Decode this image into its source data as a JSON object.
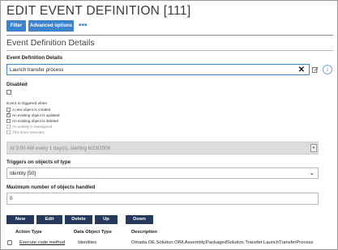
{
  "page": {
    "title": "EDIT EVENT DEFINITION [111]"
  },
  "toolbar": {
    "filter_label": "Filter",
    "advanced_label": "Advanced options",
    "more_label": "•••"
  },
  "section": {
    "title": "Event Definition Details"
  },
  "form": {
    "name_label": "Event Definition Details",
    "name_value": "Launch transfer process",
    "disabled_label": "Disabled",
    "disabled_checked": false,
    "trigger_label": "Event is triggered when",
    "trigger_options": [
      {
        "label": "A new object is created",
        "checked": false,
        "muted": false
      },
      {
        "label": "An existing object is updated",
        "checked": true,
        "muted": false
      },
      {
        "label": "An existing object is deleted",
        "checked": false,
        "muted": false
      },
      {
        "label": "An activity is reassigned",
        "checked": false,
        "muted": true
      },
      {
        "label": "This timer executes",
        "checked": false,
        "muted": true
      }
    ],
    "timer_value": "At 3:00 AM every 1 day(s), starting 6/23/2008",
    "object_type_label": "Triggers on objects of type",
    "object_type_value": "Identity [50]",
    "max_objects_label": "Maximum number of objects handled",
    "max_objects_value": "0"
  },
  "actions": {
    "new_label": "New",
    "edit_label": "Edit",
    "delete_label": "Delete",
    "up_label": "Up",
    "down_label": "Down"
  },
  "table": {
    "headers": [
      "Action Type",
      "Data Object Type",
      "Description"
    ],
    "rows": [
      {
        "action_type": "Execute code method",
        "data_object_type": "Identities",
        "description": "Omada.OE.Solution.OIM.Assembly.PackagedSolution.Transfer.LaunchTransferProcess"
      }
    ]
  },
  "colors": {
    "toolbar_button": "#3d82cc",
    "action_button": "#26395c",
    "disabled_field": "#dcdcdc"
  }
}
